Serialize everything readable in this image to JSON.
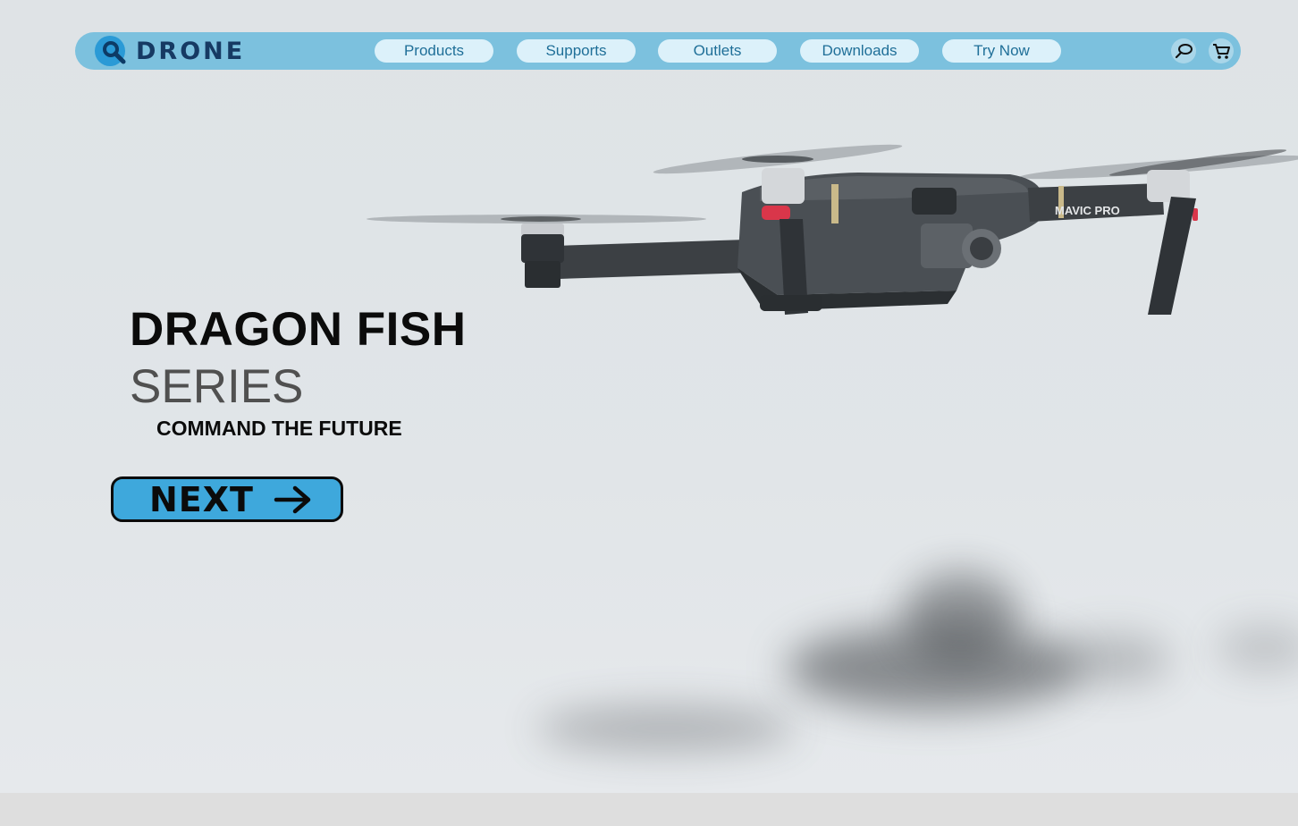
{
  "brand": {
    "name": "DRONE"
  },
  "nav": {
    "items": [
      {
        "label": "Products"
      },
      {
        "label": "Supports"
      },
      {
        "label": "Outlets"
      },
      {
        "label": "Downloads"
      },
      {
        "label": "Try Now"
      }
    ],
    "icons": [
      "search-icon",
      "cart-icon"
    ]
  },
  "hero": {
    "title": "DRAGON FISH",
    "subtitle": "SERIES",
    "tagline": "COMMAND THE FUTURE",
    "cta_label": "NEXT",
    "drone_label": "MAVIC PRO"
  },
  "colors": {
    "navbar": "#7cc1de",
    "nav_pill": "#dcf1fa",
    "nav_text": "#1f6f98",
    "logo_text": "#163a63",
    "cta": "#3ea8dc",
    "background": "#dfe3e6"
  }
}
